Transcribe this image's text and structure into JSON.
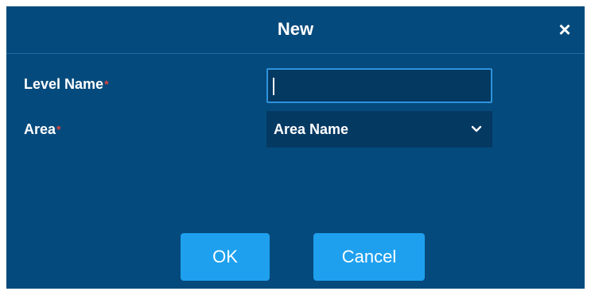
{
  "dialog": {
    "title": "New",
    "close_symbol": "×",
    "fields": {
      "level_name": {
        "label": "Level Name",
        "required_marker": "*",
        "value": "",
        "placeholder": ""
      },
      "area": {
        "label": "Area",
        "required_marker": "*",
        "selected": "Area Name"
      }
    },
    "buttons": {
      "ok": "OK",
      "cancel": "Cancel"
    }
  },
  "icons": {
    "close": "close-icon",
    "dropdown": "chevron-down-icon"
  },
  "colors": {
    "background": "#054a7c",
    "field_background": "#043962",
    "focus_border": "#2d93dd",
    "button": "#1ea0ee",
    "required": "#e0443a"
  }
}
